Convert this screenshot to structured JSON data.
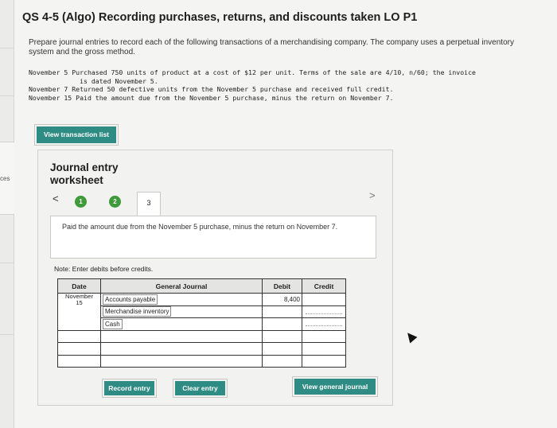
{
  "sidebar": {
    "label": "ces"
  },
  "header": {
    "title": "QS 4-5 (Algo) Recording purchases, returns, and discounts taken LO P1"
  },
  "instructions": "Prepare journal entries to record each of the following transactions of a merchandising company. The company uses a perpetual inventory system and the gross method.",
  "transactions": [
    "November 5 Purchased 750 units of product at a cost of $12 per unit. Terms of the sale are 4/10, n/60; the invoice",
    "             is dated November 5.",
    "November 7 Returned 50 defective units from the November 5 purchase and received full credit.",
    "November 15 Paid the amount due from the November 5 purchase, minus the return on November 7."
  ],
  "buttons": {
    "view_transaction_list": "View transaction list",
    "record_entry": "Record entry",
    "clear_entry": "Clear entry",
    "view_general_journal": "View general journal"
  },
  "worksheet": {
    "title": "Journal entry worksheet",
    "steps": [
      "1",
      "2",
      "3"
    ],
    "active_step": "3",
    "nav_prev": "<",
    "nav_next": ">",
    "description": "Paid the amount due from the November 5 purchase, minus the return on November 7.",
    "note": "Note: Enter debits before credits."
  },
  "journal": {
    "headers": {
      "date": "Date",
      "account": "General Journal",
      "debit": "Debit",
      "credit": "Credit"
    },
    "date_month": "November",
    "date_day": "15",
    "rows": [
      {
        "account": "Accounts payable",
        "debit": "8,400",
        "credit": ""
      },
      {
        "account": "Merchandise inventory",
        "debit": "",
        "credit": ""
      },
      {
        "account": "Cash",
        "debit": "",
        "credit": ""
      },
      {
        "account": "",
        "debit": "",
        "credit": ""
      },
      {
        "account": "",
        "debit": "",
        "credit": ""
      },
      {
        "account": "",
        "debit": "",
        "credit": ""
      }
    ]
  },
  "colors": {
    "accent": "#2f8c84",
    "step_done": "#3f9a3a"
  }
}
